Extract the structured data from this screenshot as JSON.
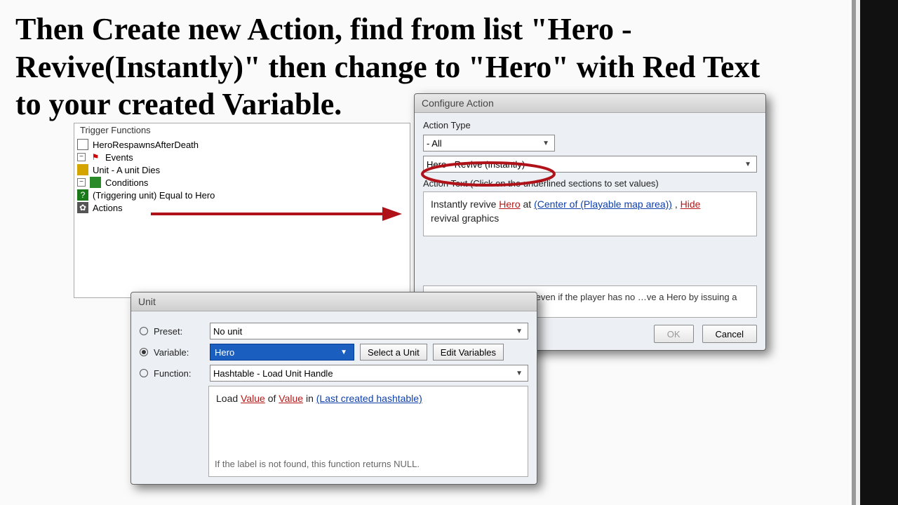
{
  "caption": "Then Create new Action, find from list \"Hero - Revive(Instantly)\" then change to \"Hero\" with Red Text to your created Variable.",
  "tree": {
    "header": "Trigger Functions",
    "root": "HeroRespawnsAfterDeath",
    "events_label": "Events",
    "event1": "Unit - A unit Dies",
    "conditions_label": "Conditions",
    "cond1": "(Triggering unit) Equal to Hero",
    "actions_label": "Actions"
  },
  "configure": {
    "title": "Configure Action",
    "action_type_label": "Action Type",
    "action_type_value": "- All",
    "action_selected": "Hero - Revive (Instantly)",
    "action_text_label": "Action Text (Click on the underlined sections to set values)",
    "t_instant": "Instantly revive",
    "t_hero": "Hero",
    "t_at": "at",
    "t_center": "(Center of (Playable map area))",
    "t_comma": ",",
    "t_hide": "Hide",
    "t_suffix": "revival graphics",
    "hint": "…o at a spot on the map, even if the player has no …ve a Hero by issuing a 'Revive' order to an",
    "ok": "OK",
    "cancel": "Cancel"
  },
  "unit": {
    "title": "Unit",
    "preset_label": "Preset:",
    "preset_value": "No unit",
    "variable_label": "Variable:",
    "variable_value": "Hero",
    "select_unit": "Select a Unit",
    "edit_vars": "Edit Variables",
    "function_label": "Function:",
    "function_value": "Hashtable - Load Unit Handle",
    "fn_load": "Load",
    "fn_value": "Value",
    "fn_of": "of",
    "fn_in": "in",
    "fn_hash": "(Last created hashtable)",
    "null_hint": "If the label is not found, this function returns NULL."
  }
}
